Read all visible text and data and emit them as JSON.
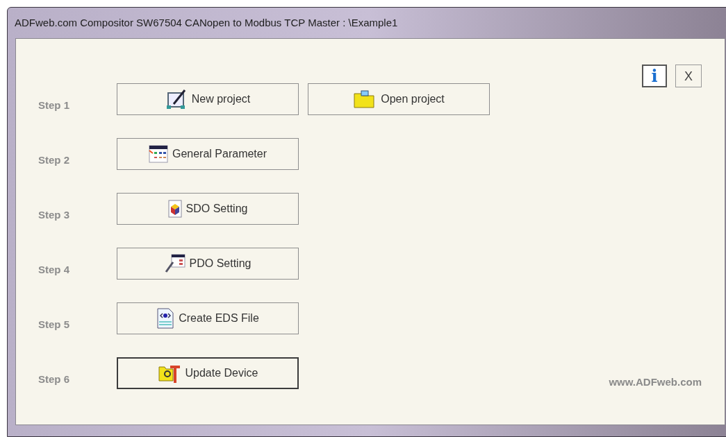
{
  "window": {
    "title": "ADFweb.com Compositor SW67504 CANopen to Modbus TCP Master : \\Example1"
  },
  "top_buttons": [
    {
      "kind": "info",
      "label": "i"
    },
    {
      "kind": "close",
      "label": "X"
    }
  ],
  "steps": [
    {
      "label": "Step 1",
      "buttons": [
        {
          "label": "New project",
          "focused": false
        },
        {
          "label": "Open project",
          "focused": false
        }
      ]
    },
    {
      "label": "Step 2",
      "buttons": [
        {
          "label": "General Parameter",
          "focused": false
        }
      ]
    },
    {
      "label": "Step 3",
      "buttons": [
        {
          "label": "SDO Setting",
          "focused": false
        }
      ]
    },
    {
      "label": "Step 4",
      "buttons": [
        {
          "label": "PDO Setting",
          "focused": false
        }
      ]
    },
    {
      "label": "Step 5",
      "buttons": [
        {
          "label": "Create EDS File",
          "focused": false
        }
      ]
    },
    {
      "label": "Step 6",
      "buttons": [
        {
          "label": "Update Device",
          "focused": true
        }
      ]
    }
  ],
  "website": "www.ADFweb.com"
}
